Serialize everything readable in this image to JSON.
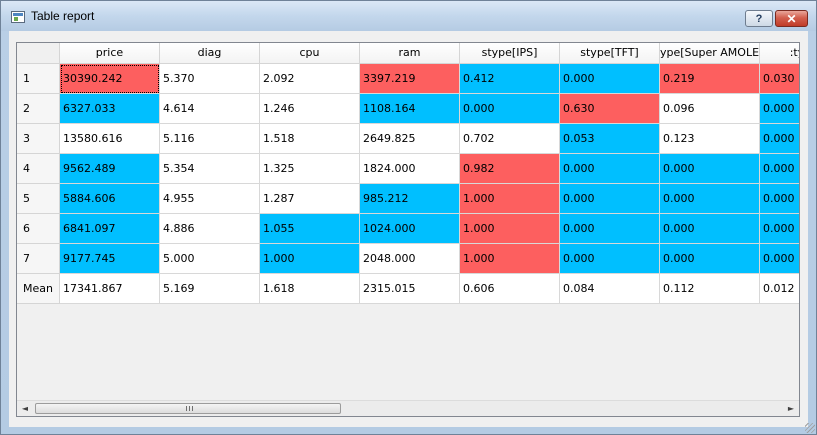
{
  "window": {
    "title": "Table report",
    "help_label": "?",
    "close_label": "✕",
    "icon": "window-app-icon"
  },
  "table": {
    "columns": [
      "price",
      "diag",
      "cpu",
      "ram",
      "stype[IPS]",
      "stype[TFT]",
      "ype[Super AMOLE",
      ":type[S"
    ],
    "rows": [
      {
        "label": "1",
        "cells": [
          {
            "v": "30390.242",
            "c": "hi"
          },
          {
            "v": "5.370",
            "c": ""
          },
          {
            "v": "2.092",
            "c": ""
          },
          {
            "v": "3397.219",
            "c": "hi"
          },
          {
            "v": "0.412",
            "c": "lo"
          },
          {
            "v": "0.000",
            "c": "lo"
          },
          {
            "v": "0.219",
            "c": "hi"
          },
          {
            "v": "0.030",
            "c": "hi"
          }
        ]
      },
      {
        "label": "2",
        "cells": [
          {
            "v": "6327.033",
            "c": "lo"
          },
          {
            "v": "4.614",
            "c": ""
          },
          {
            "v": "1.246",
            "c": ""
          },
          {
            "v": "1108.164",
            "c": "lo"
          },
          {
            "v": "0.000",
            "c": "lo"
          },
          {
            "v": "0.630",
            "c": "hi"
          },
          {
            "v": "0.096",
            "c": ""
          },
          {
            "v": "0.000",
            "c": "lo"
          }
        ]
      },
      {
        "label": "3",
        "cells": [
          {
            "v": "13580.616",
            "c": ""
          },
          {
            "v": "5.116",
            "c": ""
          },
          {
            "v": "1.518",
            "c": ""
          },
          {
            "v": "2649.825",
            "c": ""
          },
          {
            "v": "0.702",
            "c": ""
          },
          {
            "v": "0.053",
            "c": "lo"
          },
          {
            "v": "0.123",
            "c": ""
          },
          {
            "v": "0.000",
            "c": "lo"
          }
        ]
      },
      {
        "label": "4",
        "cells": [
          {
            "v": "9562.489",
            "c": "lo"
          },
          {
            "v": "5.354",
            "c": ""
          },
          {
            "v": "1.325",
            "c": ""
          },
          {
            "v": "1824.000",
            "c": ""
          },
          {
            "v": "0.982",
            "c": "hi"
          },
          {
            "v": "0.000",
            "c": "lo"
          },
          {
            "v": "0.000",
            "c": "lo"
          },
          {
            "v": "0.000",
            "c": "lo"
          }
        ]
      },
      {
        "label": "5",
        "cells": [
          {
            "v": "5884.606",
            "c": "lo"
          },
          {
            "v": "4.955",
            "c": ""
          },
          {
            "v": "1.287",
            "c": ""
          },
          {
            "v": "985.212",
            "c": "lo"
          },
          {
            "v": "1.000",
            "c": "hi"
          },
          {
            "v": "0.000",
            "c": "lo"
          },
          {
            "v": "0.000",
            "c": "lo"
          },
          {
            "v": "0.000",
            "c": "lo"
          }
        ]
      },
      {
        "label": "6",
        "cells": [
          {
            "v": "6841.097",
            "c": "lo"
          },
          {
            "v": "4.886",
            "c": ""
          },
          {
            "v": "1.055",
            "c": "lo"
          },
          {
            "v": "1024.000",
            "c": "lo"
          },
          {
            "v": "1.000",
            "c": "hi"
          },
          {
            "v": "0.000",
            "c": "lo"
          },
          {
            "v": "0.000",
            "c": "lo"
          },
          {
            "v": "0.000",
            "c": "lo"
          }
        ]
      },
      {
        "label": "7",
        "cells": [
          {
            "v": "9177.745",
            "c": "lo"
          },
          {
            "v": "5.000",
            "c": ""
          },
          {
            "v": "1.000",
            "c": "lo"
          },
          {
            "v": "2048.000",
            "c": ""
          },
          {
            "v": "1.000",
            "c": "hi"
          },
          {
            "v": "0.000",
            "c": "lo"
          },
          {
            "v": "0.000",
            "c": "lo"
          },
          {
            "v": "0.000",
            "c": "lo"
          }
        ]
      },
      {
        "label": "Mean",
        "cells": [
          {
            "v": "17341.867",
            "c": ""
          },
          {
            "v": "5.169",
            "c": ""
          },
          {
            "v": "1.618",
            "c": ""
          },
          {
            "v": "2315.015",
            "c": ""
          },
          {
            "v": "0.606",
            "c": ""
          },
          {
            "v": "0.084",
            "c": ""
          },
          {
            "v": "0.112",
            "c": ""
          },
          {
            "v": "0.012",
            "c": ""
          }
        ]
      }
    ]
  },
  "scrollbar": {
    "left_arrow": "◄",
    "right_arrow": "►"
  },
  "colors": {
    "high": "#fd5f5f",
    "low": "#00bfff"
  }
}
